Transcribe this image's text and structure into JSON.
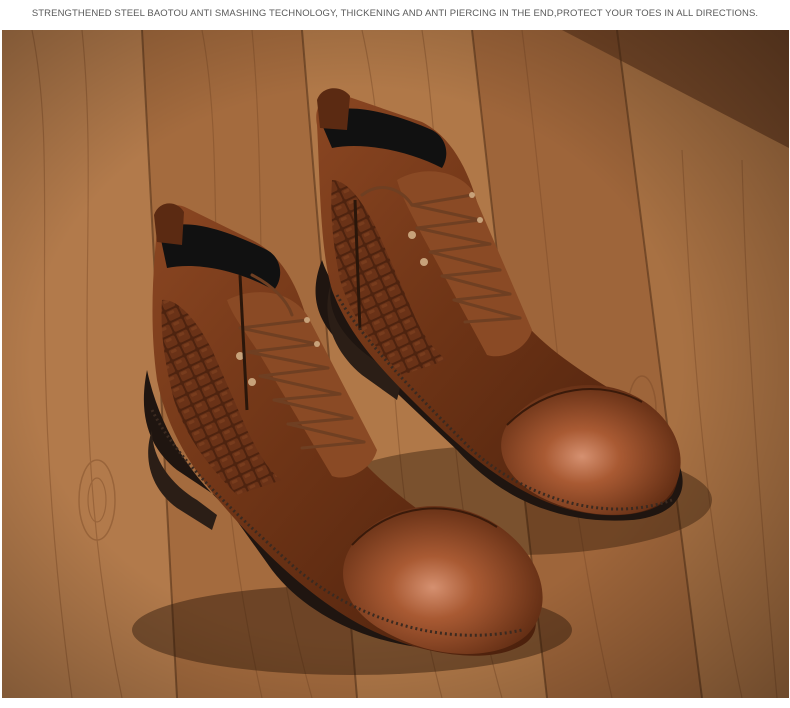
{
  "caption": {
    "text": "STRENGTHENED STEEL BAOTOU ANTI SMASHING TECHNOLOGY, THICKENING AND ANTI PIERCING IN THE END,PROTECT YOUR TOES IN ALL DIRECTIONS."
  },
  "photo": {
    "subject": "pair of brown leather lace-up ankle boots with side zippers and crocodile-textured panels on a wooden plank floor",
    "colors": {
      "wood_light": "#b98556",
      "wood_mid": "#9a6438",
      "wood_dark": "#6e4323",
      "leather": "#7a3f1c",
      "leather_highlight": "#b8714a",
      "leather_dark": "#4a220e",
      "sole": "#221812",
      "lining": "#141414",
      "lace": "#7b4a2c"
    }
  }
}
